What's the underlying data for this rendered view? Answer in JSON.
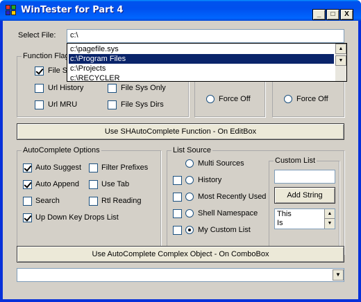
{
  "window": {
    "title": "WinTester for Part 4",
    "minimize_label": "_",
    "maximize_label": "□",
    "close_label": "X"
  },
  "select_file": {
    "label": "Select File:",
    "value": "c:\\"
  },
  "autocomplete_list": {
    "items": [
      "c:\\pagefile.sys",
      "c:\\Program Files",
      "c:\\Projects",
      "c:\\RECYCLER"
    ],
    "selected_index": 1
  },
  "function_flags": {
    "title": "Function Flags",
    "options": [
      {
        "label": "File Sys",
        "checked": true
      },
      {
        "label": "Url History",
        "checked": false
      },
      {
        "label": "File Sys Only",
        "checked": false
      },
      {
        "label": "Url MRU",
        "checked": false
      },
      {
        "label": "File Sys Dirs",
        "checked": false
      }
    ]
  },
  "force_groups": [
    {
      "label": "Force Off",
      "checked": false
    },
    {
      "label": "Force Off",
      "checked": false
    }
  ],
  "shauto_button": "Use SHAutoComplete Function - On EditBox",
  "autocomplete_options": {
    "title": "AutoComplete Options",
    "options": [
      {
        "label": "Auto Suggest",
        "checked": true
      },
      {
        "label": "Filter Prefixes",
        "checked": false
      },
      {
        "label": "Auto Append",
        "checked": true
      },
      {
        "label": "Use Tab",
        "checked": false
      },
      {
        "label": "Search",
        "checked": false
      },
      {
        "label": "Rtl Reading",
        "checked": false
      },
      {
        "label": "Up Down Key Drops List",
        "checked": true
      }
    ]
  },
  "list_source": {
    "title": "List Source",
    "items": [
      {
        "label": "Multi Sources",
        "checked": false
      },
      {
        "label": "History",
        "checked": false
      },
      {
        "label": "Most Recently Used",
        "checked": false
      },
      {
        "label": "Shell Namespace",
        "checked": false
      },
      {
        "label": "My Custom List",
        "checked": true
      }
    ]
  },
  "custom_list": {
    "title": "Custom List",
    "input_value": "",
    "add_button": "Add String",
    "entries": [
      "This",
      "Is"
    ]
  },
  "complex_button": "Use AutoComplete Complex Object - On ComboBox",
  "bottom_combo": {
    "value": ""
  }
}
